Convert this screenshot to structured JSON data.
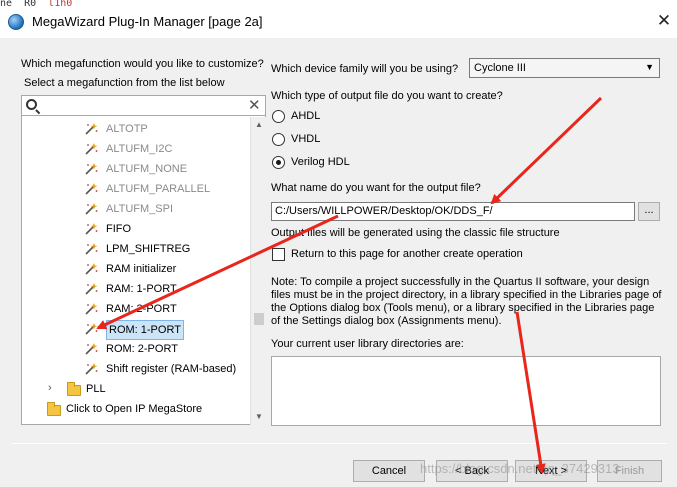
{
  "background_code": {
    "text": "ne  R0  ",
    "highlight": "l1h0"
  },
  "window": {
    "title": "MegaWizard Plug-In Manager [page 2a]",
    "close_glyph": "✕"
  },
  "left": {
    "question": "Which megafunction would you like to customize?",
    "instruction": "Select a megafunction from the list below",
    "search_value": "",
    "tree": [
      {
        "label": "ALTOTP",
        "enabled": false,
        "selected": false
      },
      {
        "label": "ALTUFM_I2C",
        "enabled": false,
        "selected": false
      },
      {
        "label": "ALTUFM_NONE",
        "enabled": false,
        "selected": false
      },
      {
        "label": "ALTUFM_PARALLEL",
        "enabled": false,
        "selected": false
      },
      {
        "label": "ALTUFM_SPI",
        "enabled": false,
        "selected": false
      },
      {
        "label": "FIFO",
        "enabled": true,
        "selected": false
      },
      {
        "label": "LPM_SHIFTREG",
        "enabled": true,
        "selected": false
      },
      {
        "label": "RAM initializer",
        "enabled": true,
        "selected": false
      },
      {
        "label": "RAM: 1-PORT",
        "enabled": true,
        "selected": false
      },
      {
        "label": "RAM: 2-PORT",
        "enabled": true,
        "selected": false
      },
      {
        "label": "ROM: 1-PORT",
        "enabled": true,
        "selected": true
      },
      {
        "label": "ROM: 2-PORT",
        "enabled": true,
        "selected": false
      },
      {
        "label": "Shift register (RAM-based)",
        "enabled": true,
        "selected": false
      }
    ],
    "pll_folder": "PLL",
    "megastore_link": "Click to Open IP MegaStore"
  },
  "right": {
    "device_family_label": "Which device family will you be using?",
    "device_family_value": "Cyclone III",
    "output_type_label": "Which type of output file do you want to create?",
    "output_types": [
      {
        "label": "AHDL",
        "checked": false
      },
      {
        "label": "VHDL",
        "checked": false
      },
      {
        "label": "Verilog HDL",
        "checked": true
      }
    ],
    "output_name_label": "What name do you want for the output file?",
    "output_name_value": "C:/Users/WILLPOWER/Desktop/OK/DDS_F/",
    "browse_label": "...",
    "classic_note": "Output files will be generated using the classic file structure",
    "return_checkbox_label": "Return to this page for another create operation",
    "return_checked": false,
    "note_lines": [
      "Note: To compile a project successfully in the Quartus II software, your design",
      "files must be in the project directory, in a library specified in the Libraries page of",
      "the Options dialog box (Tools menu), or a library specified in the Libraries page",
      "of the Settings dialog box (Assignments menu)."
    ],
    "library_dirs_label": "Your current user library directories are:"
  },
  "footer": {
    "cancel": "Cancel",
    "back": "< Back",
    "next": "Next >",
    "finish": "Finish",
    "watermark": "https://blog.csdn.net/qq_37429313"
  },
  "colors": {
    "annotation_arrow": "#e8261c",
    "selection": "#cce4f7"
  }
}
